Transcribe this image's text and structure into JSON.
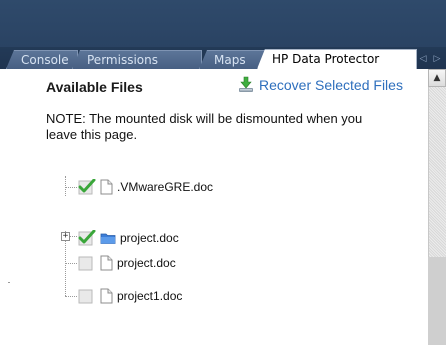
{
  "tabs": [
    {
      "label": "Console",
      "active": false
    },
    {
      "label": "Permissions",
      "active": false
    },
    {
      "label": "Maps",
      "active": false
    },
    {
      "label": "HP Data Protector",
      "active": true
    }
  ],
  "tab_scroll": {
    "left_icon": "chevron-left-icon",
    "right_icon": "chevron-right-icon"
  },
  "panel": {
    "title": "Available Files",
    "recover_label": "Recover Selected Files",
    "recover_icon": "recover-download-icon",
    "note": "NOTE: The mounted disk will be dismounted when you leave this page."
  },
  "files": [
    {
      "name": ".VMwareGRE.doc",
      "checked": true,
      "icon": "document-icon",
      "has_expander": false
    },
    {
      "name": "project.doc",
      "checked": true,
      "icon": "folder-icon",
      "has_expander": true
    },
    {
      "name": "project.doc",
      "checked": false,
      "icon": "document-icon",
      "has_expander": false
    },
    {
      "name": "project1.doc",
      "checked": false,
      "icon": "document-icon",
      "has_expander": false
    }
  ],
  "colors": {
    "header": "#2f4a6b",
    "link": "#2e6fbd",
    "check_green": "#3aa63a",
    "folder_blue": "#3b7dd8"
  }
}
